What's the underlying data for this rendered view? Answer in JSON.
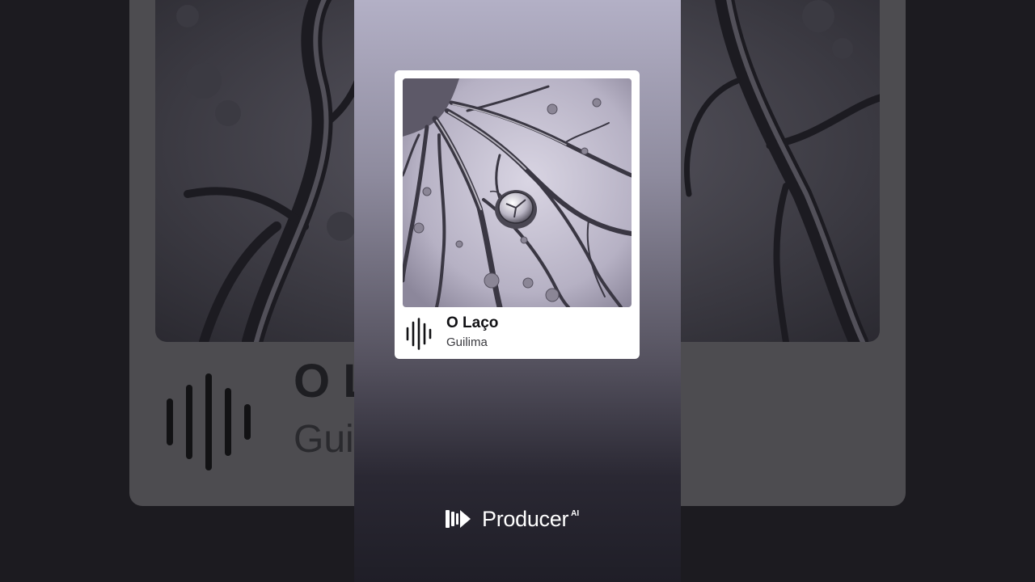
{
  "song": {
    "title": "O Laço",
    "artist": "Guilima"
  },
  "background_card": {
    "title_partial": "O L",
    "artist_partial": "Gui"
  },
  "brand": {
    "name": "Producer",
    "suffix": "AI"
  },
  "icons": {
    "waveform": "audio-waveform-icon",
    "logo": "producer-logo-icon"
  },
  "colors": {
    "panel_top": "#b3b0c6",
    "panel_bottom": "#1f1e27",
    "card": "#ffffff",
    "text_dark": "#111114"
  }
}
